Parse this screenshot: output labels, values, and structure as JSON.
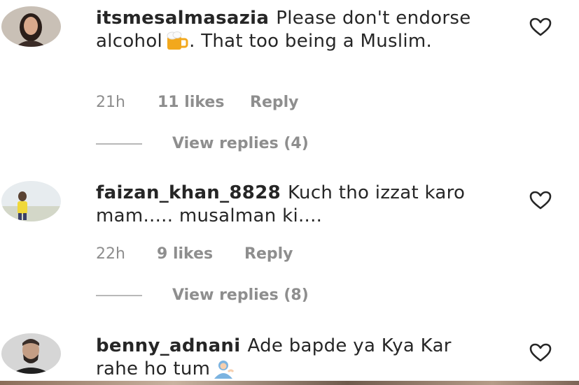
{
  "comments": [
    {
      "username": "itsmesalmasazia",
      "text_before_emoji": "Please don't endorse alcohol",
      "emoji": "beer-mug-emoji",
      "text_after_emoji": ". That too being a Muslim.",
      "time": "21h",
      "likes": "11 likes",
      "reply": "Reply",
      "view_replies": "View replies (4)"
    },
    {
      "username": "faizan_khan_8828",
      "text": "Kuch tho izzat karo mam..... musalman ki....",
      "time": "22h",
      "likes": "9 likes",
      "reply": "Reply",
      "view_replies": "View replies (8)"
    },
    {
      "username": "benny_adnani",
      "text": "Ade bapde ya Kya Kar rahe ho tum",
      "emoji": "person-tipping-hand-emoji"
    }
  ],
  "icons": {
    "like": "heart-outline-icon"
  },
  "colors": {
    "meta": "#8e8e8e",
    "text": "#262626"
  }
}
